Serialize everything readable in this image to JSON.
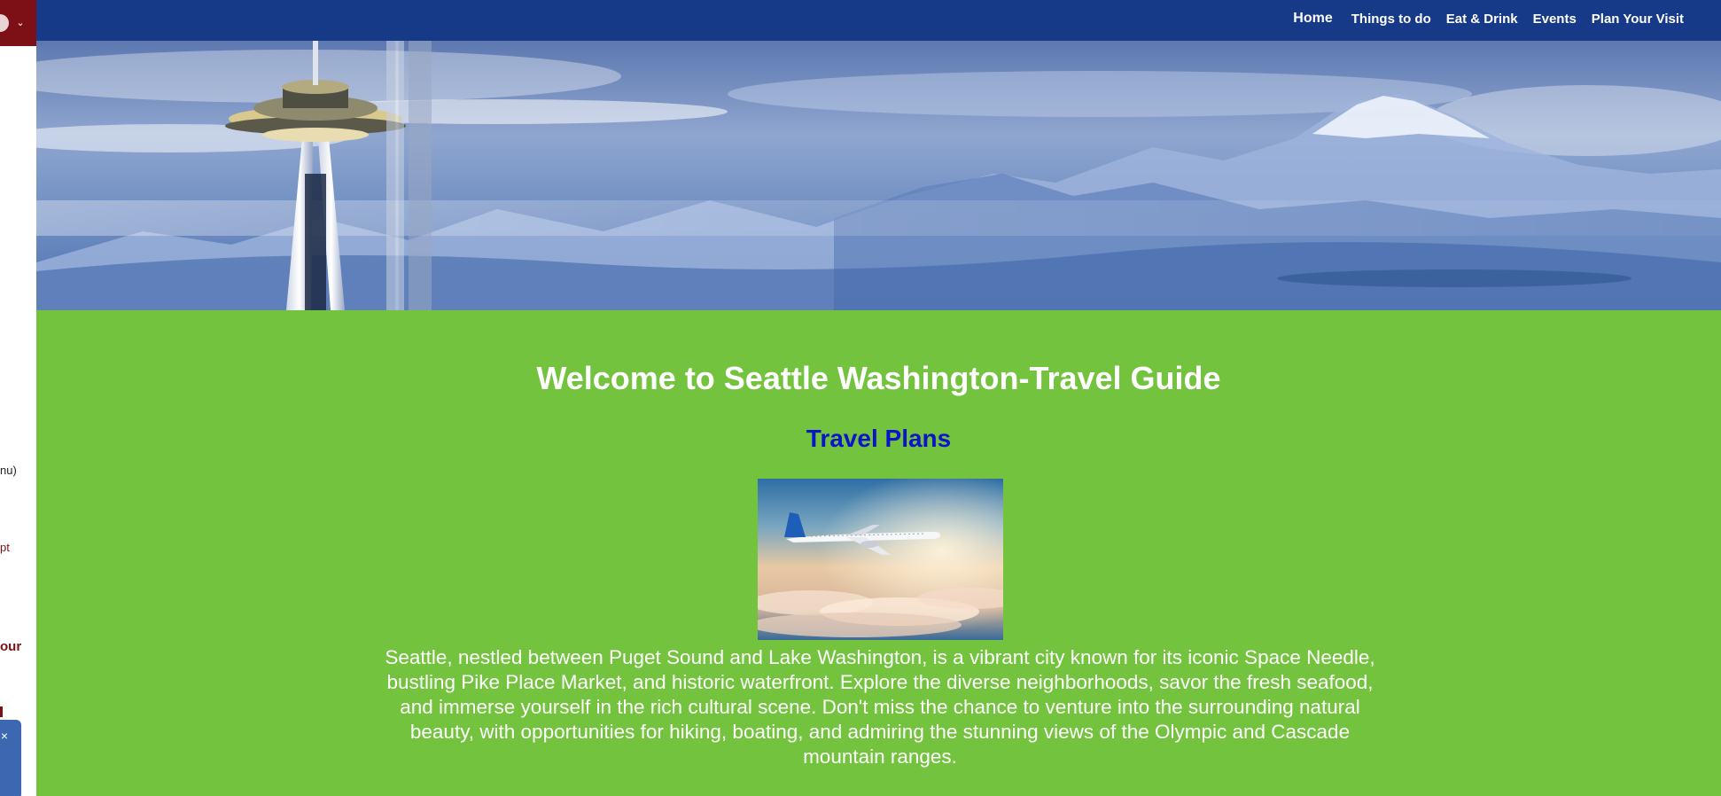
{
  "nav": {
    "items": [
      {
        "label": "Home"
      },
      {
        "label": "Things to do"
      },
      {
        "label": "Eat & Drink"
      },
      {
        "label": "Events"
      },
      {
        "label": "Plan Your Visit"
      }
    ]
  },
  "left_panel": {
    "fragments": [
      "nu)",
      "pt",
      "our"
    ],
    "close_glyph": "×"
  },
  "main": {
    "title": "Welcome to Seattle Washington-Travel Guide",
    "subtitle": "Travel Plans",
    "description": "Seattle, nestled between Puget Sound and Lake Washington, is a vibrant city known for its iconic Space Needle, bustling Pike Place Market, and historic waterfront. Explore the diverse neighborhoods, savor the fresh seafood, and immerse yourself in the rich cultural scene. Don't miss the chance to venture into the surrounding natural beauty, with opportunities for hiking, boating, and admiring the stunning views of the Olympic and Cascade mountain ranges."
  },
  "colors": {
    "nav_bg": "#163a87",
    "content_bg": "#74c33e",
    "subtitle": "#0b14c9",
    "profile_chip": "#7d0f16"
  },
  "icons": {
    "profile_chevron": "chevron-down-icon",
    "close": "close-icon"
  }
}
